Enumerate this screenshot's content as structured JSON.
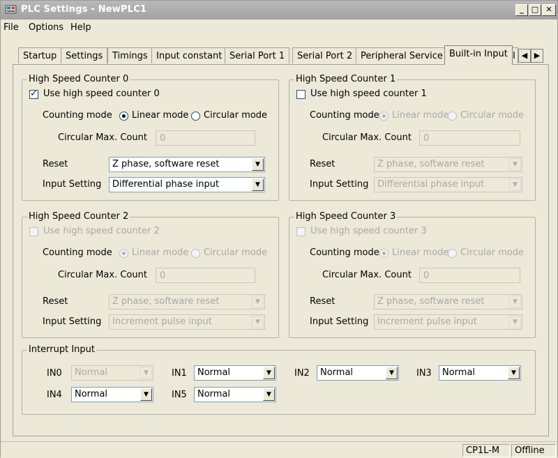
{
  "window": {
    "title": "PLC Settings - NewPLC1"
  },
  "menu": [
    "File",
    "Options",
    "Help"
  ],
  "tabs": [
    "Startup",
    "Settings",
    "Timings",
    "Input constant",
    "Serial Port 1",
    "Serial Port 2",
    "Peripheral Service",
    "Built-in Input"
  ],
  "active_tab": "Built-in Input",
  "counters": [
    {
      "title": "High Speed Counter 0",
      "use_label": "Use high speed counter 0",
      "enabled": true,
      "checked": true,
      "counting_mode_label": "Counting mode",
      "linear": "Linear mode",
      "circular": "Circular mode",
      "max_label": "Circular Max. Count",
      "max_value": "0",
      "reset_label": "Reset",
      "reset_value": "Z phase, software reset",
      "input_label": "Input Setting",
      "input_value": "Differential phase input"
    },
    {
      "title": "High Speed Counter 1",
      "use_label": "Use high speed counter 1",
      "enabled": true,
      "checked": false,
      "counting_mode_label": "Counting mode",
      "linear": "Linear mode",
      "circular": "Circular mode",
      "max_label": "Circular Max. Count",
      "max_value": "0",
      "reset_label": "Reset",
      "reset_value": "Z phase, software reset",
      "input_label": "Input Setting",
      "input_value": "Differential phase input"
    },
    {
      "title": "High Speed Counter 2",
      "use_label": "Use high speed counter 2",
      "enabled": false,
      "checked": false,
      "counting_mode_label": "Counting mode",
      "linear": "Linear mode",
      "circular": "Circular mode",
      "max_label": "Circular Max. Count",
      "max_value": "0",
      "reset_label": "Reset",
      "reset_value": "Z phase, software reset",
      "input_label": "Input Setting",
      "input_value": "Increment pulse input"
    },
    {
      "title": "High Speed Counter 3",
      "use_label": "Use high speed counter 3",
      "enabled": false,
      "checked": false,
      "counting_mode_label": "Counting mode",
      "linear": "Linear mode",
      "circular": "Circular mode",
      "max_label": "Circular Max. Count",
      "max_value": "0",
      "reset_label": "Reset",
      "reset_value": "Z phase, software reset",
      "input_label": "Input Setting",
      "input_value": "Increment pulse input"
    }
  ],
  "interrupt": {
    "title": "Interrupt Input",
    "inputs": [
      {
        "label": "IN0",
        "value": "Normal"
      },
      {
        "label": "IN1",
        "value": "Normal"
      },
      {
        "label": "IN2",
        "value": "Normal"
      },
      {
        "label": "IN3",
        "value": "Normal"
      },
      {
        "label": "IN4",
        "value": "Normal"
      },
      {
        "label": "IN5",
        "value": "Normal"
      }
    ]
  },
  "status": {
    "model": "CP1L-M",
    "state": "Offline"
  }
}
